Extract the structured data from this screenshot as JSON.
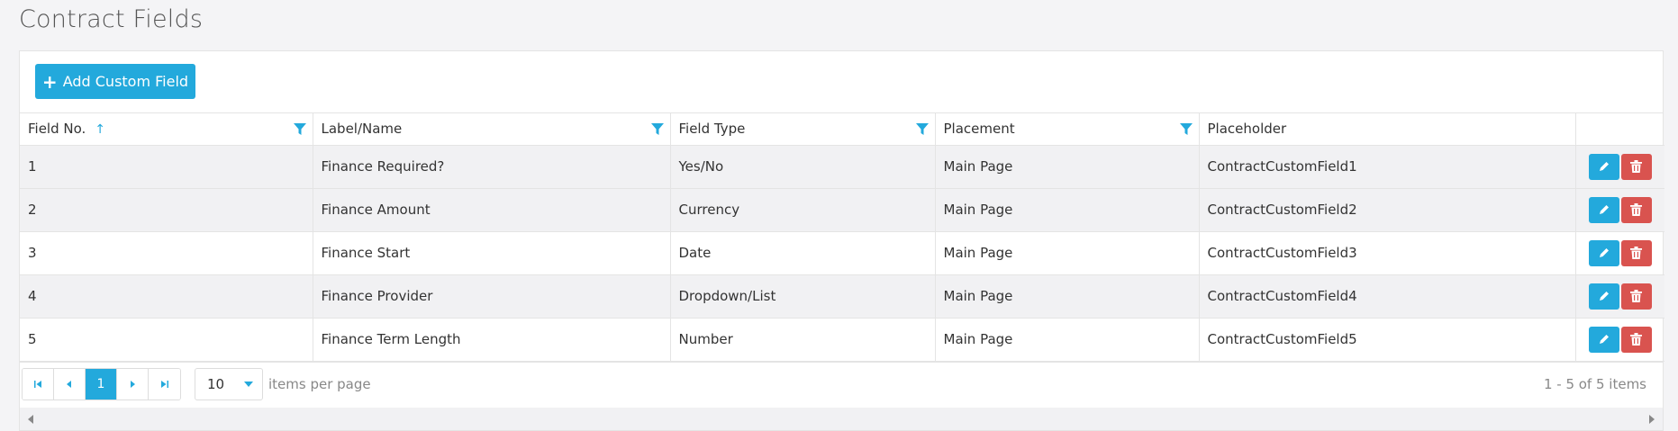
{
  "page": {
    "title": "Contract Fields"
  },
  "toolbar": {
    "add_label": "Add Custom Field"
  },
  "table": {
    "columns": [
      "Field No.",
      "Label/Name",
      "Field Type",
      "Placement",
      "Placeholder",
      ""
    ],
    "sort_indicator": "↑",
    "rows": [
      [
        "1",
        "Finance Required?",
        "Yes/No",
        "Main Page",
        "ContractCustomField1"
      ],
      [
        "2",
        "Finance Amount",
        "Currency",
        "Main Page",
        "ContractCustomField2"
      ],
      [
        "3",
        "Finance Start",
        "Date",
        "Main Page",
        "ContractCustomField3"
      ],
      [
        "4",
        "Finance Provider",
        "Dropdown/List",
        "Main Page",
        "ContractCustomField4"
      ],
      [
        "5",
        "Finance Term Length",
        "Number",
        "Main Page",
        "ContractCustomField5"
      ]
    ]
  },
  "pager": {
    "current_page": "1",
    "page_size": "10",
    "per_page_label": "items per page",
    "info": "1 - 5 of 5 items"
  },
  "colors": {
    "accent": "#23a9dc",
    "danger": "#d9534f"
  }
}
